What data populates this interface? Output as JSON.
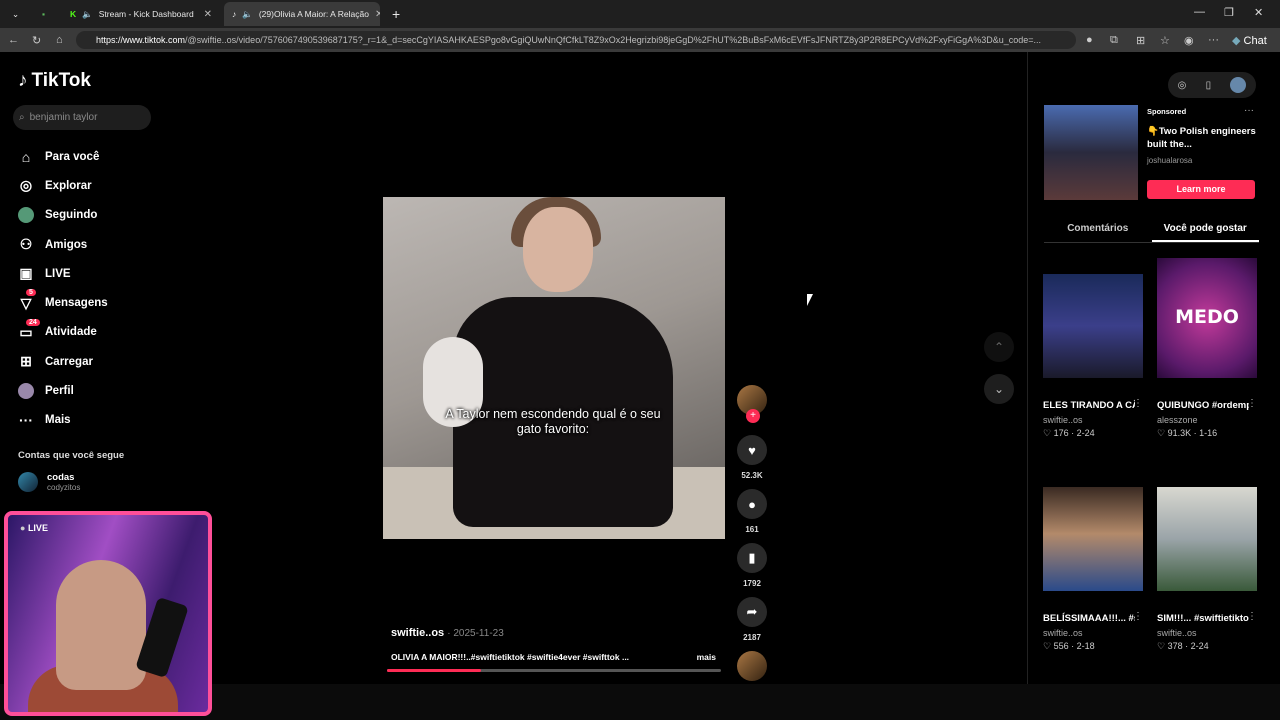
{
  "browser": {
    "tabs": [
      {
        "label": "Stream - Kick Dashboard"
      },
      {
        "label": "(29)Olivia A Maior: A Relação"
      }
    ],
    "url_host": "https://www.tiktok.com",
    "url_rest": "/@swiftie..os/video/7576067490539687175?_r=1&_d=secCgYIASAHKAESPgo8vGgiQUwNnQfCfkLT8Z9xOx2Hegrizbi98jeGgD%2FhUT%2BuBsFxM6cEVfFsJFNRTZ8y3P2R8EPCyVd%2FxyFiGgA%3D&u_code=...",
    "chat_label": "Chat"
  },
  "tiktok": {
    "logo": "TikTok",
    "search_placeholder": "benjamin taylor",
    "nav": [
      {
        "label": "Para você",
        "icon": "home-icon"
      },
      {
        "label": "Explorar",
        "icon": "compass-icon"
      },
      {
        "label": "Seguindo",
        "icon": "following-avatar-icon"
      },
      {
        "label": "Amigos",
        "icon": "friends-icon"
      },
      {
        "label": "LIVE",
        "icon": "live-icon"
      },
      {
        "label": "Mensagens",
        "icon": "messages-icon",
        "badge": "5"
      },
      {
        "label": "Atividade",
        "icon": "activity-icon",
        "badge": "24"
      },
      {
        "label": "Carregar",
        "icon": "upload-icon"
      },
      {
        "label": "Perfil",
        "icon": "profile-avatar-icon"
      },
      {
        "label": "Mais",
        "icon": "more-icon"
      }
    ],
    "following_title": "Contas que você segue",
    "following": [
      {
        "name": "codas",
        "handle": "codyzitos"
      }
    ]
  },
  "video": {
    "caption": "A Taylor nem escondendo qual é o seu gato favorito:",
    "author": "swiftie..os",
    "date": "· 2025-11-23",
    "description": "OLIVIA A MAIOR!!!..#swiftietiktok #swiftie4ever #swifttok ...",
    "more": "mais",
    "progress": 0.28,
    "likes": "52.3K",
    "comments": "161",
    "saves": "1792",
    "shares": "2187"
  },
  "sidebar_right": {
    "ad": {
      "label": "Sponsored",
      "title": "👇Two Polish engineers built the...",
      "author": "joshualarosa",
      "button": "Learn more"
    },
    "tabs": [
      {
        "label": "Comentários",
        "active": false
      },
      {
        "label": "Você pode gostar",
        "active": true
      }
    ],
    "cards": [
      {
        "title": "ELES TIRANDO A CÂMERA DE...",
        "user": "swiftie..os",
        "stats": "176 · 2-24"
      },
      {
        "title": "QUIBUNGO #ordemparanor...",
        "user": "alesszone",
        "stats": "91.3K · 1-16",
        "thumb_text": "MEDO"
      },
      {
        "title": "BELÍSSIMAAA!!!... #swiftietiktok...",
        "user": "swiftie..os",
        "stats": "556 · 2-18"
      },
      {
        "title": "SIM!!!... #swiftietiktok...",
        "user": "swiftie..os",
        "stats": "378 · 2-24"
      }
    ]
  },
  "webcam": {
    "live_label": "LIVE"
  }
}
